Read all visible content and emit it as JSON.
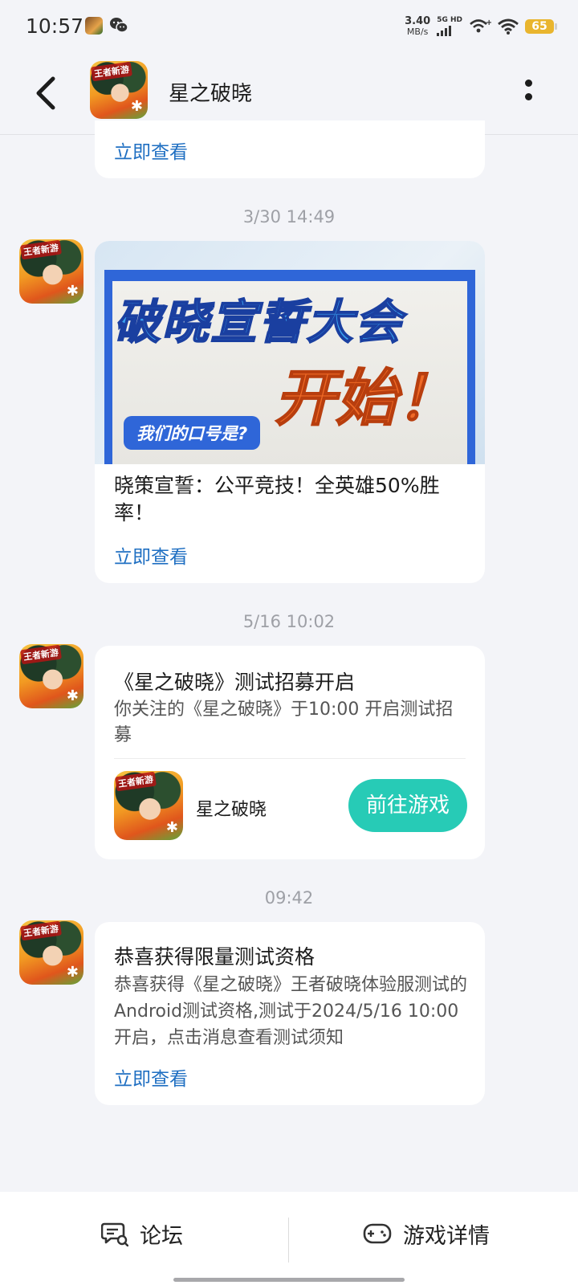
{
  "status_bar": {
    "time": "10:57",
    "net_speed_value": "3.40",
    "net_speed_unit": "MB/s",
    "network_label": "5G HD",
    "battery": "65"
  },
  "header": {
    "title": "星之破晓"
  },
  "avatar_tag": "王者新游",
  "messages": [
    {
      "link": "立即查看"
    },
    {
      "timestamp": "3/30  14:49",
      "banner": {
        "line1": "破晓宣誓大会",
        "line2": "开始！",
        "pill": "我们的口号是?"
      },
      "title": "晓策宣誓：公平竞技！全英雄50%胜率！",
      "link": "立即查看"
    },
    {
      "timestamp": "5/16  10:02",
      "title": "《星之破晓》测试招募开启",
      "body": "你关注的《星之破晓》于10:00 开启测试招募",
      "game_name": "星之破晓",
      "button": "前往游戏"
    },
    {
      "timestamp": "09:42",
      "title": "恭喜获得限量测试资格",
      "body": "恭喜获得《星之破晓》王者破晓体验服测试的Android测试资格,测试于2024/5/16 10:00 开启，点击消息查看测试须知",
      "link": "立即查看"
    }
  ],
  "bottom_bar": {
    "forum": "论坛",
    "game_details": "游戏详情"
  },
  "colors": {
    "background": "#f3f4f8",
    "link": "#1f6fc2",
    "accent_button": "#27cbb6",
    "battery": "#e9b52e"
  }
}
